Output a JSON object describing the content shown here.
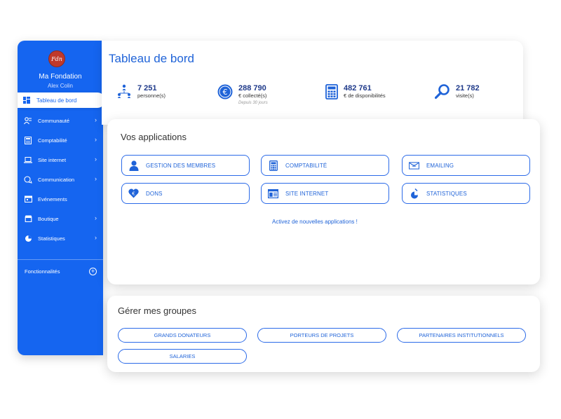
{
  "sidebar": {
    "logo_text": "Fdn",
    "org_name": "Ma Fondation",
    "user_name": "Alex Colin",
    "active_item": "Tableau de bord",
    "items": [
      {
        "label": "Communauté",
        "icon": "community-icon",
        "chevron": "›"
      },
      {
        "label": "Comptabilité",
        "icon": "calculator-icon",
        "chevron": "›"
      },
      {
        "label": "Site internet",
        "icon": "laptop-icon",
        "chevron": "›"
      },
      {
        "label": "Communication",
        "icon": "chat-icon",
        "chevron": "›"
      },
      {
        "label": "Evénements",
        "icon": "calendar-icon",
        "chevron": ""
      },
      {
        "label": "Boutique",
        "icon": "shop-icon",
        "chevron": "›"
      },
      {
        "label": "Statistiques",
        "icon": "pie-chart-icon",
        "chevron": "›"
      }
    ],
    "functionalities_label": "Fonctionnalités",
    "functionalities_plus": "+"
  },
  "header": {
    "title": "Tableau de bord"
  },
  "stats": [
    {
      "value": "7 251",
      "label": "personne(s)",
      "icon": "people-network-icon"
    },
    {
      "value": "288 790",
      "label": "€ collecté(s)",
      "sub": "Depuis 30 jours",
      "icon": "euro-coin-icon"
    },
    {
      "value": "482 761",
      "label": "€ de disponibilités",
      "icon": "calculator-icon"
    },
    {
      "value": "21 782",
      "label": "visite(s)",
      "icon": "magnifier-icon"
    }
  ],
  "apps": {
    "title": "Vos applications",
    "buttons": [
      {
        "label": "GESTION DES MEMBRES",
        "icon": "member-icon"
      },
      {
        "label": "COMPTABILITÉ",
        "icon": "calculator-icon"
      },
      {
        "label": "EMAILING",
        "icon": "mail-icon"
      },
      {
        "label": "DONS",
        "icon": "euro-heart-icon"
      },
      {
        "label": "SITE INTERNET",
        "icon": "website-icon"
      },
      {
        "label": "STATISTIQUES",
        "icon": "stats-icon"
      }
    ],
    "activate_link": "Activez de nouvelles applications !"
  },
  "groups": {
    "title": "Gérer mes groupes",
    "buttons": [
      "GRANDS DONATEURS",
      "PORTEURS DE PROJETS",
      "PARTENAIRES INSTITUTIONNELS",
      "SALARIES"
    ]
  },
  "colors": {
    "primary": "#1565f0",
    "accent_text": "#1f63d8",
    "logo": "#c0392b"
  }
}
